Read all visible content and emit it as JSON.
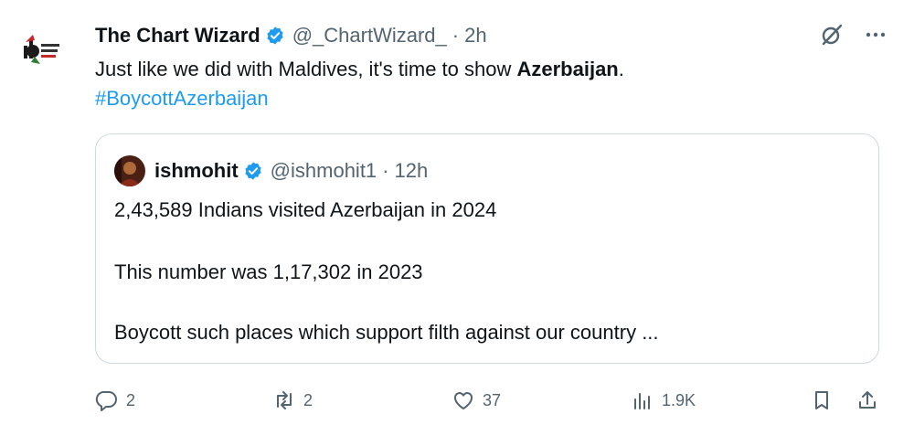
{
  "tweet": {
    "author_name": "The Chart Wizard",
    "handle": "@_ChartWizard_",
    "dot": "·",
    "time": "2h",
    "text_part1": "Just like we did with Maldives, it's time to show ",
    "text_bold": "Azerbaijan",
    "text_part2": ".",
    "hashtag": "#BoycottAzerbaijan",
    "avatar_icon": "chart-wizard-logo",
    "verified_icon": "verified-badge-icon",
    "colors": {
      "link": "#1d9bf0",
      "verified": "#1d9bf0",
      "secondary": "#536471",
      "border": "#cfd9de"
    }
  },
  "quoted": {
    "author_name": "ishmohit",
    "handle": "@ishmohit1",
    "dot": "·",
    "time": "12h",
    "line1": "2,43,589 Indians visited Azerbaijan in 2024",
    "line2": "This number was 1,17,302 in 2023",
    "line3": "Boycott such places which support filth against our country ..."
  },
  "actions": {
    "reply_count": "2",
    "retweet_count": "2",
    "like_count": "37",
    "views_count": "1.9K"
  }
}
